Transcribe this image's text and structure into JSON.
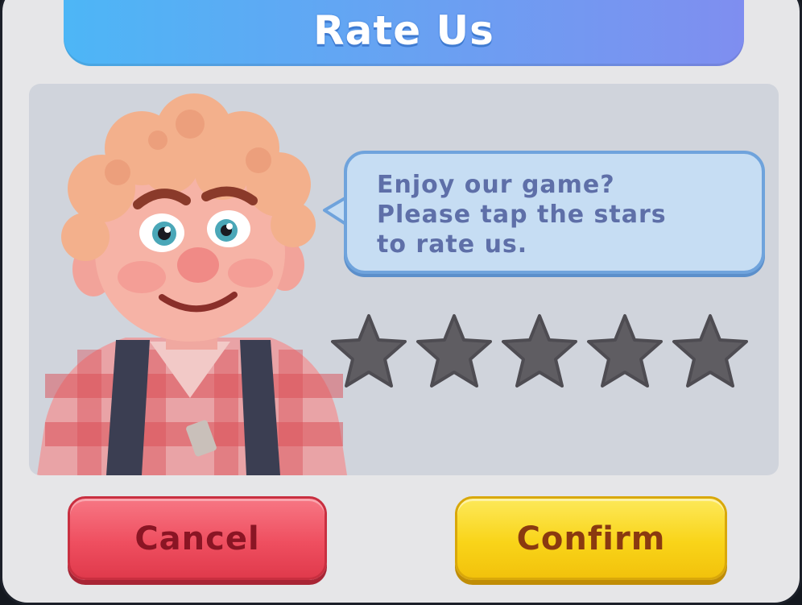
{
  "dialog": {
    "title": "Rate Us",
    "message_lines": [
      "Enjoy our game?",
      "Please tap the stars",
      "to rate us."
    ]
  },
  "rating": {
    "max_stars": 5,
    "selected": 0,
    "star_fill_empty": "#5f5d62"
  },
  "buttons": {
    "cancel_label": "Cancel",
    "confirm_label": "Confirm"
  },
  "colors": {
    "title_gradient_start": "#4db6f6",
    "title_gradient_end": "#7f8ef0",
    "cancel_red": "#ef4f60",
    "confirm_yellow": "#f9d419",
    "bubble_fill": "#c6ddf3"
  },
  "icons": {
    "star": "star-icon",
    "character": "cartoon-boy-avatar"
  }
}
